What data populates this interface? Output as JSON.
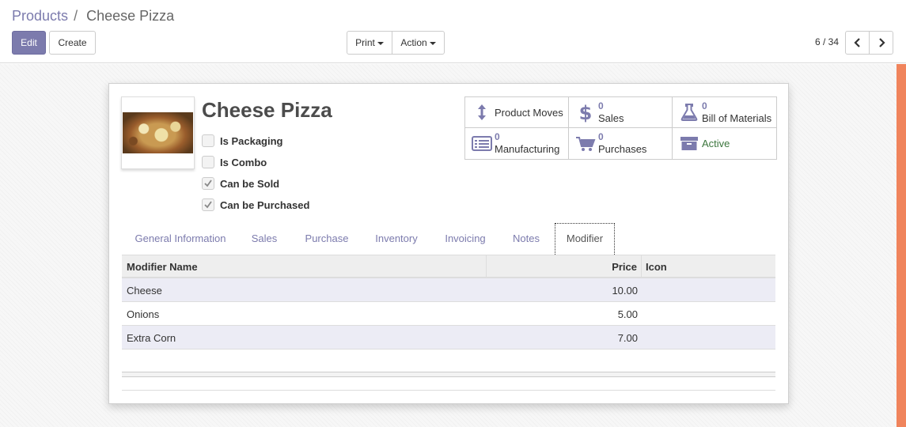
{
  "breadcrumb": {
    "parent": "Products",
    "separator": "/",
    "current": "Cheese Pizza"
  },
  "toolbar": {
    "edit_label": "Edit",
    "create_label": "Create",
    "print_label": "Print",
    "action_label": "Action"
  },
  "pager": {
    "value": "6 / 34"
  },
  "product": {
    "name": "Cheese Pizza",
    "checkboxes": [
      {
        "label": "Is Packaging",
        "checked": false
      },
      {
        "label": "Is Combo",
        "checked": false
      },
      {
        "label": "Can be Sold",
        "checked": true
      },
      {
        "label": "Can be Purchased",
        "checked": true
      }
    ]
  },
  "smart_buttons": [
    {
      "label": "Product Moves",
      "icon": "arrows-v-icon"
    },
    {
      "count": "0",
      "label": "Sales",
      "icon": "dollar-icon"
    },
    {
      "count": "0",
      "label": "Bill of Materials",
      "icon": "flask-icon"
    },
    {
      "count": "0",
      "label": "Manufacturing",
      "icon": "list-alt-icon"
    },
    {
      "count": "0",
      "label": "Purchases",
      "icon": "shopping-cart-icon"
    },
    {
      "label": "Active",
      "icon": "archive-icon"
    }
  ],
  "tabs": [
    "General Information",
    "Sales",
    "Purchase",
    "Inventory",
    "Invoicing",
    "Notes",
    "Modifier"
  ],
  "modifier_table": {
    "columns": [
      "Modifier Name",
      "Price",
      "Icon"
    ],
    "rows": [
      {
        "name": "Cheese",
        "price": "10.00",
        "icon": ""
      },
      {
        "name": "Onions",
        "price": "5.00",
        "icon": ""
      },
      {
        "name": "Extra Corn",
        "price": "7.00",
        "icon": ""
      }
    ]
  },
  "colors": {
    "brand": "#7c7bad",
    "accent": "#f0845c",
    "active_green": "#3c763d"
  }
}
